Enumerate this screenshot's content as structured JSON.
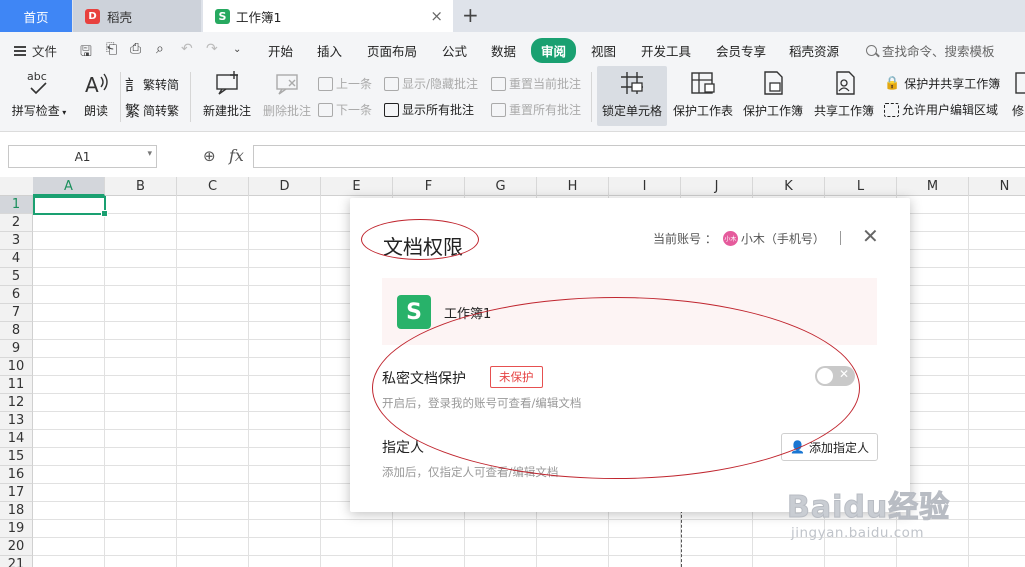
{
  "tabs": {
    "home": "首页",
    "daoke": "稻壳",
    "daoke_icon": "D",
    "workbook": "工作簿1",
    "workbook_icon": "S",
    "close": "×",
    "add": "+"
  },
  "menu": {
    "file": "文件",
    "items": [
      "开始",
      "插入",
      "页面布局",
      "公式",
      "数据",
      "审阅",
      "视图",
      "开发工具",
      "会员专享",
      "稻壳资源"
    ],
    "active": "审阅",
    "search": "查找命令、搜索模板"
  },
  "ribbon": {
    "spell_check": "拼写检查",
    "spell_check_icon_text": "abc",
    "read_aloud": "朗读",
    "trad_to_simp": "繁转简",
    "simp_to_trad": "简转繁",
    "new_comment": "新建批注",
    "delete_comment": "删除批注",
    "prev": "上一条",
    "next": "下一条",
    "show_hide_comment": "显示/隐藏批注",
    "show_all_comments": "显示所有批注",
    "reset_current_comment": "重置当前批注",
    "reset_all_comments": "重置所有批注",
    "lock_cell": "锁定单元格",
    "protect_sheet": "保护工作表",
    "protect_workbook": "保护工作簿",
    "share_workbook": "共享工作簿",
    "protect_and_share": "保护并共享工作簿",
    "allow_edit_ranges": "允许用户编辑区域",
    "modify_partial": "修"
  },
  "formula_bar": {
    "name_box": "A1",
    "fx": "fx",
    "value": ""
  },
  "grid": {
    "columns": [
      "A",
      "B",
      "C",
      "D",
      "E",
      "F",
      "G",
      "H",
      "I",
      "J",
      "K",
      "L",
      "M",
      "N"
    ],
    "rows": [
      "1",
      "2",
      "3",
      "4",
      "5",
      "6",
      "7",
      "8",
      "9",
      "10",
      "11",
      "12",
      "13",
      "14",
      "15",
      "16",
      "17",
      "18",
      "19",
      "20",
      "21"
    ],
    "selected_column": "A",
    "selected_row": "1"
  },
  "dialog": {
    "title": "文档权限",
    "account_label": "当前账号 ：",
    "account_avatar_text": "小木",
    "account_name": "小木（手机号）",
    "close": "✕",
    "file_icon": "S",
    "file_name": "工作簿1",
    "private_title": "私密文档保护",
    "private_status": "未保护",
    "private_desc": "开启后，登录我的账号可查看/编辑文档",
    "toggle_on": false,
    "designee_title": "指定人",
    "designee_desc": "添加后，仅指定人可查看/编辑文档",
    "add_designee": "添加指定人"
  },
  "colors": {
    "accent": "#1aa071",
    "home_tab": "#3f86f5",
    "annotation": "#c0262f",
    "badge": "#e64444"
  },
  "watermark": {
    "brand": "Baidu经验",
    "url": "jingyan.baidu.com"
  }
}
